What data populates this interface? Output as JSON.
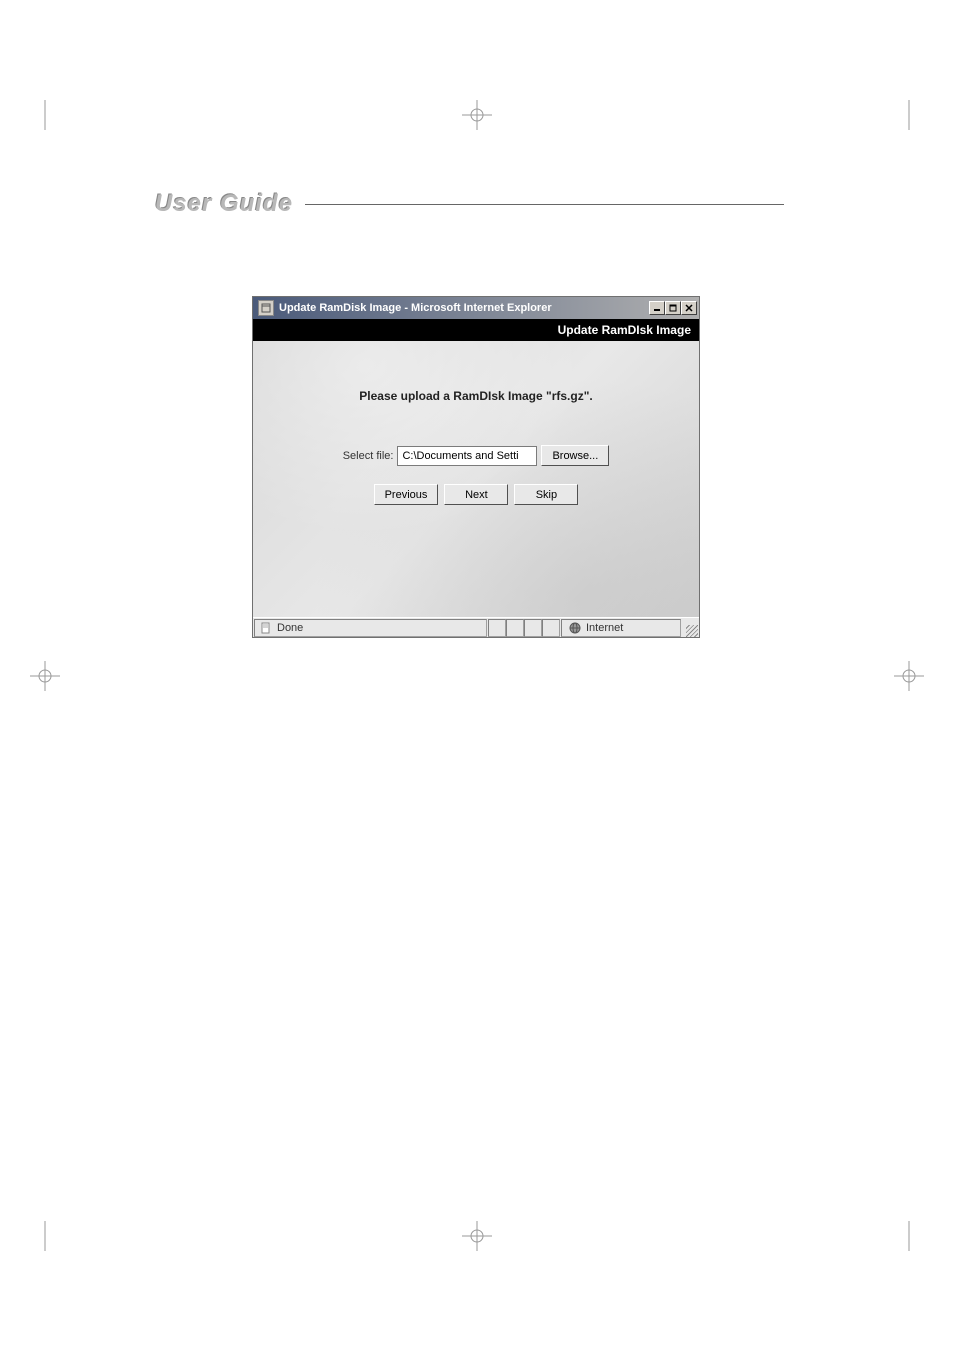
{
  "page": {
    "title": "User Guide"
  },
  "window": {
    "title": "Update RamDisk Image - Microsoft Internet Explorer",
    "header": "Update RamDIsk Image",
    "uploadPrompt": "Please upload a RamDIsk Image \"rfs.gz\".",
    "fileLabel": "Select file:",
    "fileValue": "C:\\Documents and Setti",
    "browseLabel": "Browse...",
    "previousLabel": "Previous",
    "nextLabel": "Next",
    "skipLabel": "Skip"
  },
  "statusbar": {
    "status": "Done",
    "zone": "Internet"
  }
}
